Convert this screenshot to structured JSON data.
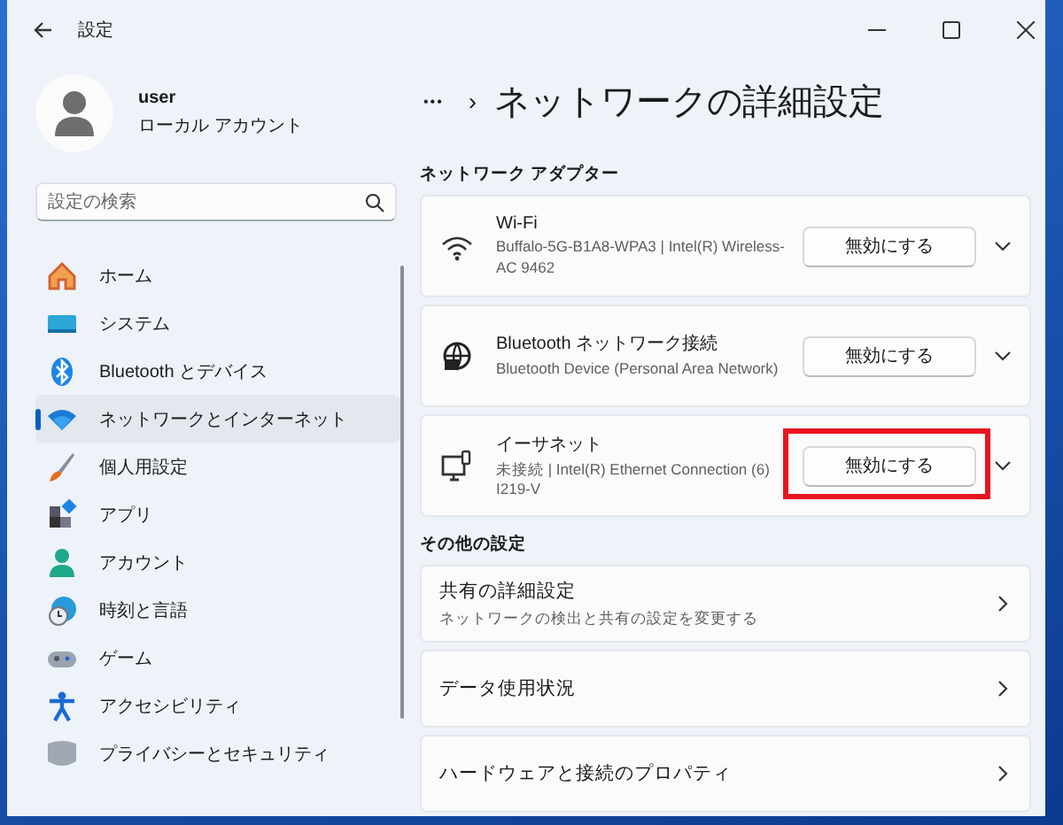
{
  "window": {
    "title": "設定"
  },
  "user": {
    "name": "user",
    "account_type": "ローカル アカウント"
  },
  "search": {
    "placeholder": "設定の検索"
  },
  "sidebar": {
    "items": [
      {
        "label": "ホーム",
        "kind": "home",
        "selected": false
      },
      {
        "label": "システム",
        "kind": "system",
        "selected": false
      },
      {
        "label": "Bluetooth とデバイス",
        "kind": "bluetooth",
        "selected": false
      },
      {
        "label": "ネットワークとインターネット",
        "kind": "network",
        "selected": true
      },
      {
        "label": "個人用設定",
        "kind": "brush",
        "selected": false
      },
      {
        "label": "アプリ",
        "kind": "apps",
        "selected": false
      },
      {
        "label": "アカウント",
        "kind": "account",
        "selected": false
      },
      {
        "label": "時刻と言語",
        "kind": "time",
        "selected": false
      },
      {
        "label": "ゲーム",
        "kind": "game",
        "selected": false
      },
      {
        "label": "アクセシビリティ",
        "kind": "accessibility",
        "selected": false
      },
      {
        "label": "プライバシーとセキュリティ",
        "kind": "privacy",
        "selected": false
      }
    ]
  },
  "breadcrumb": {
    "ellipsis": "•••",
    "separator": "›",
    "title": "ネットワークの詳細設定"
  },
  "sections": [
    {
      "kind": "adapters",
      "heading": "ネットワーク アダプター",
      "items": [
        {
          "kind": "wifi",
          "name": "Wi-Fi",
          "detail": "Buffalo-5G-B1A8-WPA3 | Intel(R) Wireless-AC 9462",
          "button": "無効にする",
          "highlighted": false
        },
        {
          "kind": "globe",
          "name": "Bluetooth ネットワーク接続",
          "detail": "Bluetooth Device (Personal Area Network)",
          "button": "無効にする",
          "highlighted": false
        },
        {
          "kind": "ethernet",
          "name": "イーサネット",
          "detail": "未接続 | Intel(R) Ethernet Connection (6) I219-V",
          "button": "無効にする",
          "highlighted": true
        }
      ]
    },
    {
      "kind": "links",
      "heading": "その他の設定",
      "items": [
        {
          "title": "共有の詳細設定",
          "subtitle": "ネットワークの検出と共有の設定を変更する"
        },
        {
          "title": "データ使用状況"
        },
        {
          "title": "ハードウェアと接続のプロパティ"
        }
      ]
    }
  ]
}
